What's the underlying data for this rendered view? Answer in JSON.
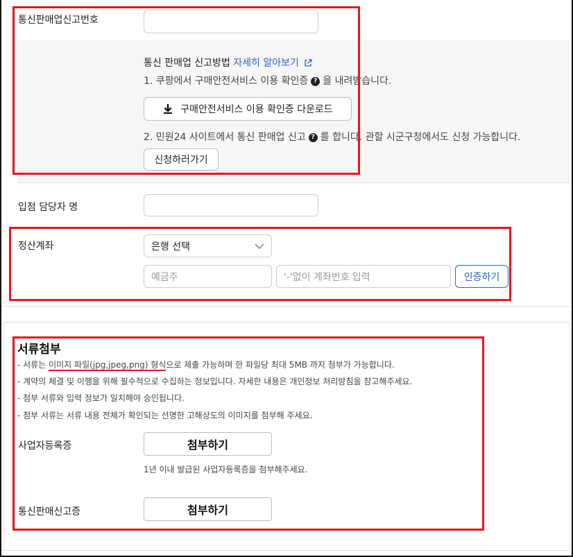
{
  "telecom": {
    "label": "통신판매업신고번호",
    "input_value": "",
    "method_title": "통신 판매업 신고방법",
    "learn_more": "자세히 알아보기",
    "step1_a": "1. 쿠팡에서 구매안전서비스 이용 확인증",
    "step1_b": "을 내려받습니다.",
    "download_button": "구매안전서비스 이용 확인증 다운로드",
    "step2_a": "2. 민원24 사이트에서 통신 판매업 신고",
    "step2_b": "를 합니다. 관할 시군구청에서도 신청 가능합니다.",
    "apply_button": "신청하러가기",
    "help_glyph": "?"
  },
  "manager": {
    "label": "입점 담당자 명",
    "input_value": ""
  },
  "settlement": {
    "label": "정산계좌",
    "bank_select": "은행 선택",
    "holder_placeholder": "예금주",
    "account_placeholder": "'-'없이 계좌번호 입력",
    "verify_button": "인증하기"
  },
  "documents": {
    "title": "서류첨부",
    "note1_a": "- 서류는",
    "note1_b": "이미지 파일(jpg,jpeg,png) 형식",
    "note1_c": "으로 제출 가능하며 한 파일당 최대 5MB 까지 첨부가 가능합니다.",
    "note2": "- 계약의 체결 및 이행을 위해 필수적으로 수집하는 정보입니다. 자세한 내용은 개인정보 처리방침을 참고해주세요.",
    "note3": "- 첨부 서류와 입력 정보가 일치해야 승인됩니다.",
    "note4": "- 첨부 서류는 서류 내용 전체가 확인되는 선명한 고해상도의 이미지를 첨부해 주세요.",
    "business_label": "사업자등록증",
    "business_attach": "첨부하기",
    "business_hint": "1년 이내 발급된 사업자등록증을 첨부해주세요.",
    "telecom_label": "통신판매신고증",
    "telecom_attach": "첨부하기"
  },
  "colors": {
    "highlight_red": "#e5161f",
    "link_blue": "#2a63c9",
    "panel_gray": "#f6f6f6"
  }
}
